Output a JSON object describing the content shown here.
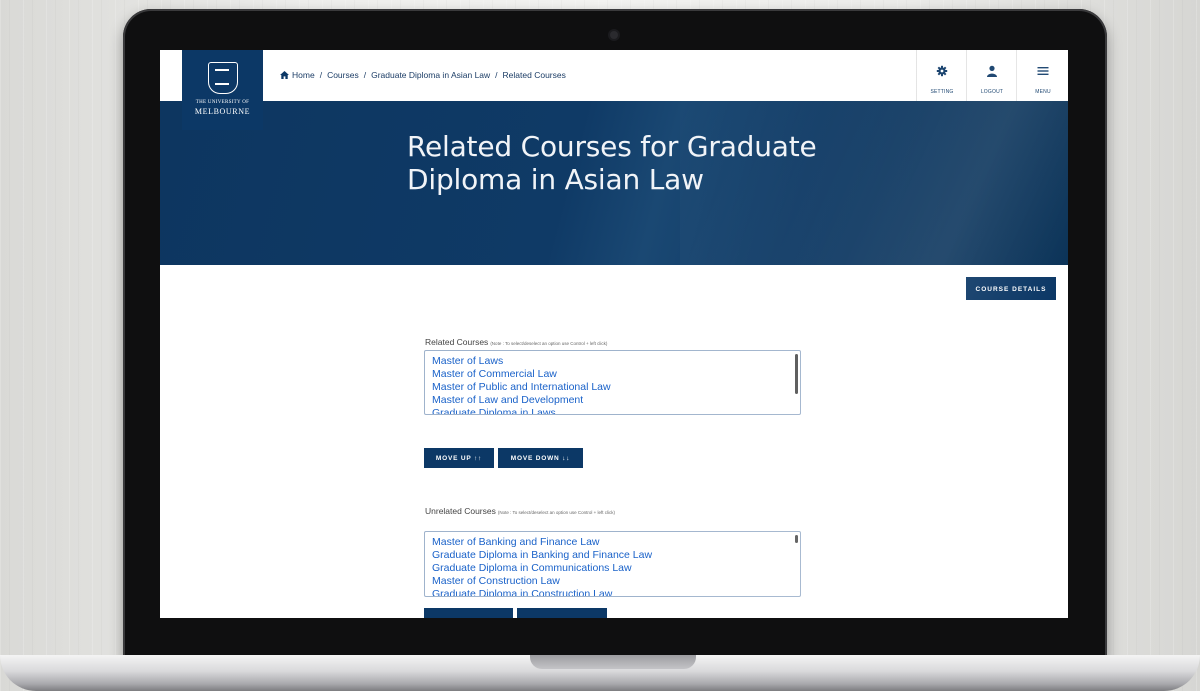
{
  "breadcrumb": {
    "home": "Home",
    "sep1": "/",
    "courses": "Courses",
    "sep2": "/",
    "course": "Graduate Diploma in Asian Law",
    "sep3": "/",
    "current": "Related Courses"
  },
  "logo": {
    "line1": "THE UNIVERSITY OF",
    "line2": "MELBOURNE"
  },
  "nav": {
    "setting": "SETTING",
    "logout": "LOGOUT",
    "menu": "MENU"
  },
  "hero": {
    "title": "Related Courses for Graduate Diploma in Asian Law"
  },
  "actions": {
    "course_details": "COURSE DETAILS",
    "move_up": "MOVE UP ↑↑",
    "move_down": "MOVE DOWN ↓↓"
  },
  "related": {
    "label": "Related Courses",
    "note": "(Note : To select/deselect an option use Control + left click)",
    "items": [
      "Master of Laws",
      "Master of Commercial Law",
      "Master of Public and International Law",
      "Master of Law and Development",
      "Graduate Diploma in Laws"
    ]
  },
  "unrelated": {
    "label": "Unrelated Courses",
    "note": "(Note : To select/deselect an option use Control + left click)",
    "items": [
      "Master of Banking and Finance Law",
      "Graduate Diploma in Banking and Finance Law",
      "Graduate Diploma in Communications Law",
      "Master of Construction Law",
      "Graduate Diploma in Construction Law"
    ]
  },
  "colors": {
    "brand_navy": "#0c3866",
    "link_blue": "#1a62c9"
  }
}
